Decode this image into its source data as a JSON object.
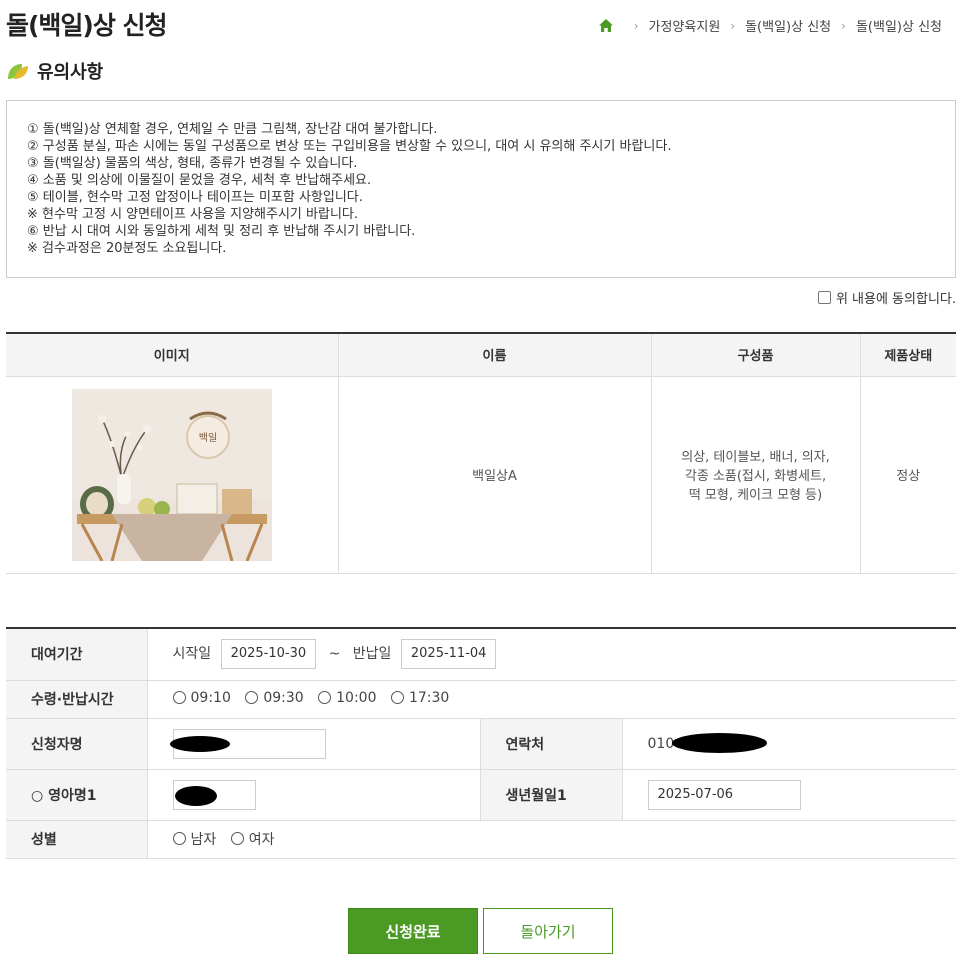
{
  "page_title": "돌(백일)상 신청",
  "breadcrumb": [
    "가정양육지원",
    "돌(백일)상 신청",
    "돌(백일)상 신청"
  ],
  "section_title": "유의사항",
  "notice_lines": [
    "① 돌(백일)상 연체할 경우, 연체일 수 만큼 그림책, 장난감 대여 불가합니다.",
    "② 구성품 분실, 파손 시에는 동일 구성품으로 변상 또는 구입비용을 변상할 수 있으니, 대여 시 유의해 주시기 바랍니다.",
    "③ 돌(백일상) 물품의 색상, 형태, 종류가 변경될 수 있습니다.",
    "④ 소품 및 의상에 이물질이 묻었을 경우, 세척 후 반납해주세요.",
    "⑤ 테이블, 현수막 고정 압정이나 테이프는 미포함 사항입니다.",
    "※ 현수막 고정 시 양면테이프 사용을 지양해주시기 바랍니다.",
    "⑥ 반납 시 대여 시와 동일하게 세척 및 정리 후 반납해 주시기 바랍니다.",
    "※ 검수과정은 20분정도 소요됩니다."
  ],
  "agree_label": "위 내용에 동의합니다.",
  "items_table": {
    "headers": [
      "이미지",
      "이름",
      "구성품",
      "제품상태"
    ],
    "row": {
      "name": "백일상A",
      "components_lines": [
        "의상, 테이블보, 배너, 의자,",
        "각종 소품(접시, 화병세트,",
        "떡 모형, 케이크 모형 등)"
      ],
      "status": "정상"
    }
  },
  "form": {
    "rental_period_label": "대여기간",
    "start_label": "시작일",
    "start_date": "2025-10-30",
    "tilde": "~",
    "return_label": "반납일",
    "return_date": "2025-11-04",
    "time_label": "수령·반납시간",
    "times": [
      "09:10",
      "09:30",
      "10:00",
      "17:30"
    ],
    "applicant_label": "신청자명",
    "contact_label": "연락처",
    "contact_prefix": "010",
    "child_label": "○ 영아명1",
    "birth_label": "생년월일1",
    "birth_value": "2025-07-06",
    "gender_label": "성별",
    "genders": [
      "남자",
      "여자"
    ]
  },
  "buttons": {
    "submit": "신청완료",
    "back": "돌아가기"
  },
  "colors": {
    "accent": "#4a9a24",
    "header_bg": "#f4f4f4"
  }
}
